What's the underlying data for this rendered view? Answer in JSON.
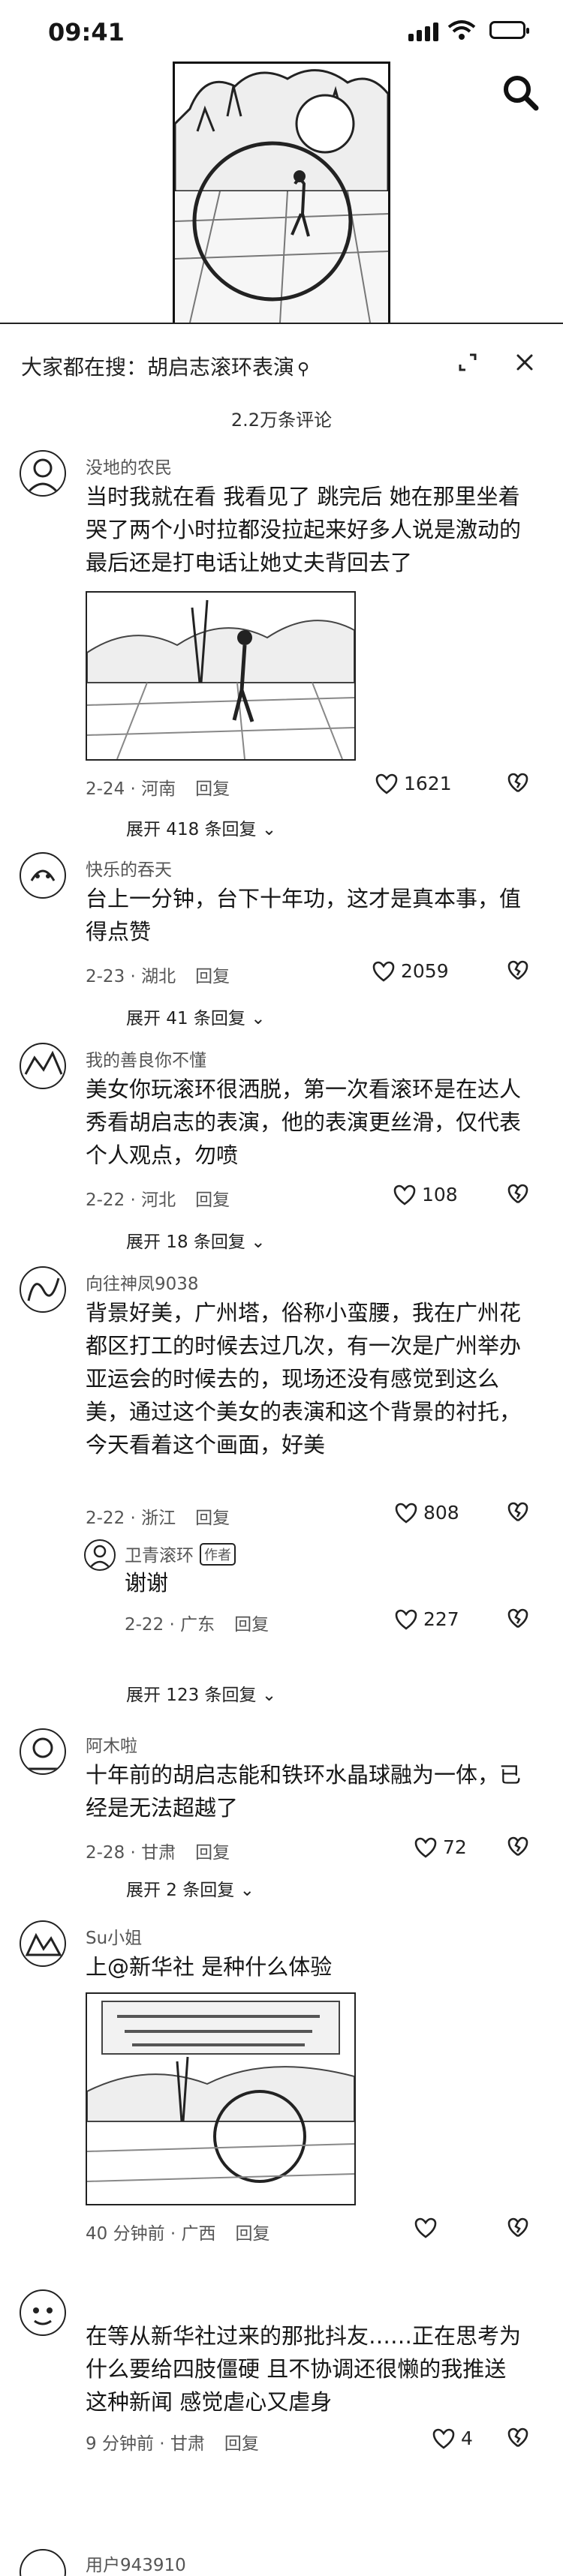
{
  "status": {
    "time": "09:41"
  },
  "search": {
    "title": "大家都在搜：胡启志滚环表演"
  },
  "comments_count": "2.2万条评论",
  "comments": [
    {
      "user": "没地的农民",
      "text": "当时我就在看 我看见了 跳完后 她在那里坐着哭了两个小时拉都没拉起来好多人说是激动的 最后还是打电话让她丈夫背回去了",
      "meta": "2-24 · 河南",
      "reply": "回复",
      "likes": "1621",
      "more": "展开 418 条回复"
    },
    {
      "user": "快乐的吞天",
      "text": "台上一分钟，台下十年功，这才是真本事，值得点赞",
      "meta": "2-23 · 湖北",
      "reply": "回复",
      "likes": "2059",
      "more": "展开 41 条回复"
    },
    {
      "user": "我的善良你不懂",
      "text": "美女你玩滚环很洒脱，第一次看滚环是在达人秀看胡启志的表演，他的表演更丝滑，仅代表个人观点，勿喷",
      "meta": "2-22 · 河北",
      "reply": "回复",
      "likes": "108",
      "more": "展开 18 条回复"
    },
    {
      "user": "向往神凤9038",
      "text": "背景好美，广州塔，俗称小蛮腰，我在广州花都区打工的时候去过几次，有一次是广州举办亚运会的时候去的，现场还没有感觉到这么美，通过这个美女的表演和这个背景的衬托，今天看着这个画面，好美",
      "meta": "2-22 · 浙江",
      "reply": "回复",
      "likes": "808",
      "sub_reply": {
        "user": "卫青滚环",
        "tag": "作者",
        "text": "谢谢",
        "meta": "2-22 · 广东",
        "reply": "回复",
        "likes": "227"
      },
      "more": "展开 123 条回复"
    },
    {
      "user": "阿木啦",
      "text": "十年前的胡启志能和铁环水晶球融为一体，已经是无法超越了",
      "meta": "2-28 · 甘肃",
      "reply": "回复",
      "likes": "72",
      "more": "展开 2 条回复"
    },
    {
      "user": "Su小姐",
      "text": "上@新华社 是种什么体验",
      "meta": "40 分钟前 · 广西",
      "reply": "回复",
      "likes": ""
    },
    {
      "user": "",
      "text": "在等从新华社过来的那批抖友……正在思考为什么要给四肢僵硬 且不协调还很懒的我推送这种新闻 感觉虐心又虐身",
      "meta": "9 分钟前 · 甘肃",
      "reply": "回复",
      "likes": "4"
    },
    {
      "user": "用户943910",
      "text": "",
      "meta": "",
      "reply": "",
      "likes": ""
    }
  ],
  "icons": {
    "search": "search-icon",
    "expand": "expand-icon",
    "close": "close-icon",
    "like": "heart-icon",
    "dislike": "broken-heart-icon",
    "chevron": "chevron-down-icon"
  }
}
